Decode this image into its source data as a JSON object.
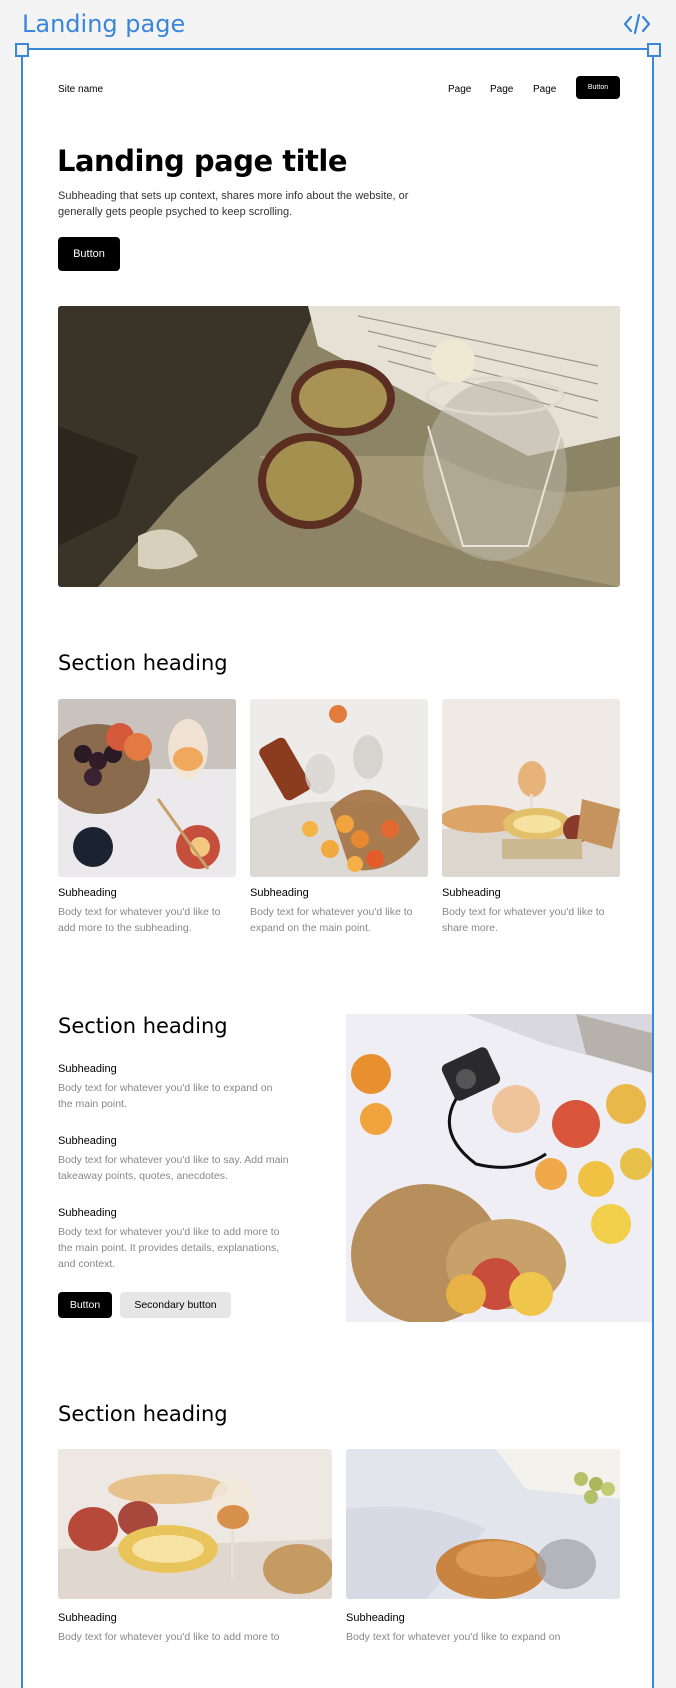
{
  "canvas": {
    "title": "Landing page"
  },
  "nav": {
    "site_name": "Site name",
    "links": [
      "Page",
      "Page",
      "Page"
    ],
    "button": "Button"
  },
  "hero": {
    "title": "Landing page title",
    "subtitle": "Subheading that sets up context, shares more info about the website, or generally gets people psyched to keep scrolling.",
    "button": "Button"
  },
  "section1": {
    "heading": "Section heading",
    "cards": [
      {
        "subheading": "Subheading",
        "body": "Body text for whatever you'd like to add more to the subheading."
      },
      {
        "subheading": "Subheading",
        "body": "Body text for whatever you'd like to expand on the main point."
      },
      {
        "subheading": "Subheading",
        "body": "Body text for whatever you'd like to share more."
      }
    ]
  },
  "section2": {
    "heading": "Section heading",
    "items": [
      {
        "subheading": "Subheading",
        "body": "Body text for whatever you'd like to expand on the main point."
      },
      {
        "subheading": "Subheading",
        "body": "Body text for whatever you'd like to say. Add main takeaway points, quotes, anecdotes."
      },
      {
        "subheading": "Subheading",
        "body": "Body text for whatever you'd like to add more to the main point. It provides details, explanations, and context."
      }
    ],
    "primary_button": "Button",
    "secondary_button": "Secondary button"
  },
  "section3": {
    "heading": "Section heading",
    "cards": [
      {
        "subheading": "Subheading",
        "body": "Body text for whatever you'd like to add more to"
      },
      {
        "subheading": "Subheading",
        "body": "Body text for whatever you'd like to expand on"
      }
    ]
  },
  "colors": {
    "accent": "#3a86d9",
    "primary": "#000000",
    "secondary_bg": "#e6e6e6",
    "muted_text": "#888888"
  },
  "icons": {
    "code": "code-brackets-icon"
  }
}
